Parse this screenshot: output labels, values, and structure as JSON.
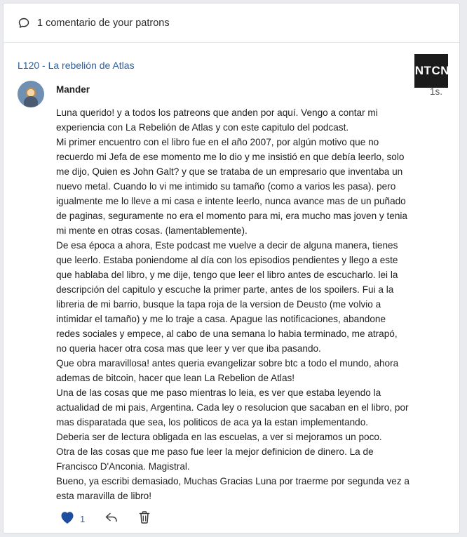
{
  "header": {
    "comment_count_label": "1 comentario de your patrons"
  },
  "post": {
    "title": "L120 - La rebelión de Atlas",
    "thumbnail_text": "ANTCN"
  },
  "comment": {
    "author": "Mander",
    "time": "1s.",
    "paragraphs": [
      "Luna querido! y a todos los patreons que anden por aquí. Vengo a contar mi experiencia con La Rebelión de Atlas y con este capitulo del podcast.",
      "Mi primer encuentro con el libro fue en el año 2007, por algún motivo que no recuerdo mi Jefa de ese momento me lo dio y me insistió en que debía leerlo, solo me dijo, Quien es John Galt? y que se trataba de un empresario que inventaba un nuevo metal. Cuando lo vi me intimido su tamaño (como a varios les pasa). pero igualmente me lo lleve a mi casa e intente leerlo, nunca avance mas de un puñado de paginas, seguramente no era el momento para mi, era mucho mas joven y tenia mi mente en otras cosas. (lamentablemente).",
      "De esa época a ahora, Este podcast me vuelve a decir de alguna manera, tienes que leerlo. Estaba poniendome al día con los episodios pendientes y llego a este que hablaba del libro, y me dije, tengo que leer el libro antes de escucharlo. lei la descripción del capitulo y escuche la primer parte, antes de los spoilers. Fui a la libreria de mi barrio, busque la tapa roja de la version de Deusto (me volvio a intimidar el tamaño) y me lo traje a casa. Apague las notificaciones, abandone redes sociales y empece, al cabo de una semana lo habia terminado, me atrapó, no queria hacer otra cosa mas que leer y ver que iba pasando.",
      "Que obra maravillosa! antes queria evangelizar sobre btc a todo el mundo, ahora ademas de bitcoin, hacer que lean La Rebelion de Atlas!",
      "Una de las cosas que me paso mientras lo leia, es ver que estaba leyendo la actualidad de mi pais, Argentina. Cada ley o resolucion que sacaban en el libro, por mas disparatada que sea, los politicos de aca ya la estan implementando.",
      "Deberia ser de lectura obligada en las escuelas, a ver si mejoramos un poco.",
      "Otra de las cosas que me paso fue leer la mejor definicion de dinero. La de Francisco D'Anconia. Magistral.",
      "Bueno, ya escribi demasiado, Muchas Gracias Luna por traerme por segunda vez a esta maravilla de libro!"
    ],
    "like_count": "1"
  },
  "icons": {
    "comment": "speech-bubble-icon",
    "like": "heart-icon",
    "reply": "reply-arrow-icon",
    "delete": "trash-icon"
  },
  "colors": {
    "link": "#2e5fa0",
    "like": "#1d4e9e",
    "background": "#e9ebee"
  }
}
